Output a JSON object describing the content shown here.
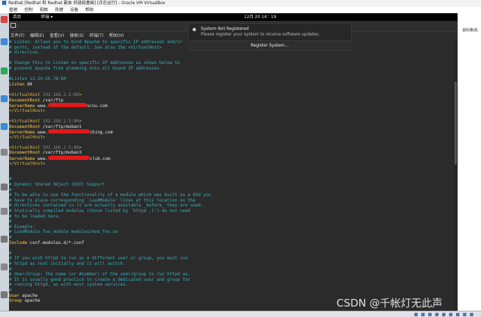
{
  "vbox": {
    "title": "Redhat [Redhat 和 Redhat 副本 的链接基础] [正在运行] - Oracle VM VirtualBox",
    "menu": [
      "管理",
      "控制",
      "视图",
      "热键",
      "设备",
      "帮助"
    ]
  },
  "host_right": {
    "text": "鼠标集成."
  },
  "gnome": {
    "activities": "活动",
    "app": "终端 ▾",
    "clock": "12月 20 14：19"
  },
  "terminal": {
    "menu": [
      "文件(F)",
      "编辑(E)",
      "查看(V)",
      "搜索(S)",
      "终端(T)",
      "帮助(H)"
    ],
    "lines": [
      [
        {
          "c": "c-comment",
          "t": "# Listen: Allows you to bind Apache to specific IP addresses and/or"
        }
      ],
      [
        {
          "c": "c-comment",
          "t": "# ports, instead of the default. See also the <VirtualHost>"
        }
      ],
      [
        {
          "c": "c-comment",
          "t": "# directive."
        }
      ],
      [
        {
          "c": "c-plain",
          "t": ""
        }
      ],
      [
        {
          "c": "c-comment",
          "t": "# Change this to Listen on specific IP addresses as shown below to"
        }
      ],
      [
        {
          "c": "c-comment",
          "t": "# prevent Apache from glomming onto all bound IP addresses."
        }
      ],
      [
        {
          "c": "c-plain",
          "t": ""
        }
      ],
      [
        {
          "c": "c-comment",
          "t": "#Listen 12.34.56.78:80"
        }
      ],
      [
        {
          "c": "c-key",
          "t": "Listen"
        },
        {
          "c": "c-plain",
          "t": " 80"
        }
      ],
      [
        {
          "c": "c-plain",
          "t": ""
        }
      ],
      [
        {
          "c": "c-tag",
          "t": "<VirtualHost"
        },
        {
          "c": "c-ip",
          "t": " 192.168.2.5:80"
        },
        {
          "c": "c-tag",
          "t": ">"
        }
      ],
      [
        {
          "c": "c-key",
          "t": "DocumentRoot"
        },
        {
          "c": "c-plain",
          "t": " /var/ftp"
        }
      ],
      [
        {
          "c": "c-key",
          "t": "ServerName"
        },
        {
          "c": "c-plain",
          "t": " www."
        },
        {
          "r": 56
        },
        {
          "c": "c-plain",
          "t": "scnu.com"
        }
      ],
      [
        {
          "c": "c-tag",
          "t": "</VirtualHost>"
        }
      ],
      [
        {
          "c": "c-plain",
          "t": ""
        }
      ],
      [
        {
          "c": "c-tag",
          "t": "<VirtualHost"
        },
        {
          "c": "c-ip",
          "t": " 192.168.2.5:80"
        },
        {
          "c": "c-tag",
          "t": ">"
        }
      ],
      [
        {
          "c": "c-key",
          "t": "DocumentRoot"
        },
        {
          "c": "c-plain",
          "t": " /var/ftp/muban1"
        }
      ],
      [
        {
          "c": "c-key",
          "t": "ServerName"
        },
        {
          "c": "c-plain",
          "t": " www."
        },
        {
          "r": 60
        },
        {
          "c": "c-plain",
          "t": "cking.com"
        }
      ],
      [
        {
          "c": "c-tag",
          "t": "</VirtualHost>"
        }
      ],
      [
        {
          "c": "c-plain",
          "t": ""
        }
      ],
      [
        {
          "c": "c-tag",
          "t": "<VirtualHost"
        },
        {
          "c": "c-ip",
          "t": " 192.168.2.5:80"
        },
        {
          "c": "c-tag",
          "t": ">"
        }
      ],
      [
        {
          "c": "c-key",
          "t": "DocumentRoot"
        },
        {
          "c": "c-plain",
          "t": " /var/ftp/muban3"
        }
      ],
      [
        {
          "c": "c-key",
          "t": "ServerName"
        },
        {
          "c": "c-plain",
          "t": " www."
        },
        {
          "r": 60
        },
        {
          "c": "c-plain",
          "t": "club.com"
        }
      ],
      [
        {
          "c": "c-tag",
          "t": "</VirtualHost>"
        }
      ],
      [
        {
          "c": "c-plain",
          "t": ""
        }
      ],
      [
        {
          "c": "c-plain",
          "t": ""
        }
      ],
      [
        {
          "c": "c-comment",
          "t": "#"
        }
      ],
      [
        {
          "c": "c-comment",
          "t": "# Dynamic Shared Object (DSO) Support"
        }
      ],
      [
        {
          "c": "c-comment",
          "t": "#"
        }
      ],
      [
        {
          "c": "c-comment",
          "t": "# To be able to use the functionality of a module which was built as a DSO you"
        }
      ],
      [
        {
          "c": "c-comment",
          "t": "# have to place corresponding `LoadModule' lines at this location so the"
        }
      ],
      [
        {
          "c": "c-comment",
          "t": "# directives contained in it are actually available _before_ they are used."
        }
      ],
      [
        {
          "c": "c-comment",
          "t": "# Statically compiled modules (those listed by `httpd -l') do not need"
        }
      ],
      [
        {
          "c": "c-comment",
          "t": "# to be loaded here."
        }
      ],
      [
        {
          "c": "c-comment",
          "t": "#"
        }
      ],
      [
        {
          "c": "c-comment",
          "t": "# Example:"
        }
      ],
      [
        {
          "c": "c-comment",
          "t": "# LoadModule foo_module modules/mod_foo.so"
        }
      ],
      [
        {
          "c": "c-comment",
          "t": "#"
        }
      ],
      [
        {
          "c": "c-key",
          "t": "Include"
        },
        {
          "c": "c-plain",
          "t": " conf.modules.d/*.conf"
        }
      ],
      [
        {
          "c": "c-plain",
          "t": ""
        }
      ],
      [
        {
          "c": "c-comment",
          "t": "#"
        }
      ],
      [
        {
          "c": "c-comment",
          "t": "# If you wish httpd to run as a different user or group, you must run"
        }
      ],
      [
        {
          "c": "c-comment",
          "t": "# httpd as root initially and it will switch."
        }
      ],
      [
        {
          "c": "c-comment",
          "t": "#"
        }
      ],
      [
        {
          "c": "c-comment",
          "t": "# User/Group: The name (or #number) of the user/group to run httpd as."
        }
      ],
      [
        {
          "c": "c-comment",
          "t": "# It is usually good practice to create a dedicated user and group for"
        }
      ],
      [
        {
          "c": "c-comment",
          "t": "# running httpd, as with most system services."
        }
      ],
      [
        {
          "c": "c-comment",
          "t": "#"
        }
      ],
      [
        {
          "c": "c-key",
          "t": "User"
        },
        {
          "c": "c-plain",
          "t": " apache"
        }
      ],
      [
        {
          "c": "c-key",
          "t": "Group"
        },
        {
          "c": "c-plain",
          "t": " apache"
        }
      ]
    ]
  },
  "notification": {
    "title": "System Not Registered",
    "body": "Please register your system to receive software updates.",
    "action": "Register System..."
  },
  "watermark": "CSDN @千帐灯无此声",
  "colors": {
    "comment": "#35b3c3",
    "keyword": "#c8a13f",
    "redact": "#e11a1a",
    "terminal_bg": "#2b2b2b"
  }
}
